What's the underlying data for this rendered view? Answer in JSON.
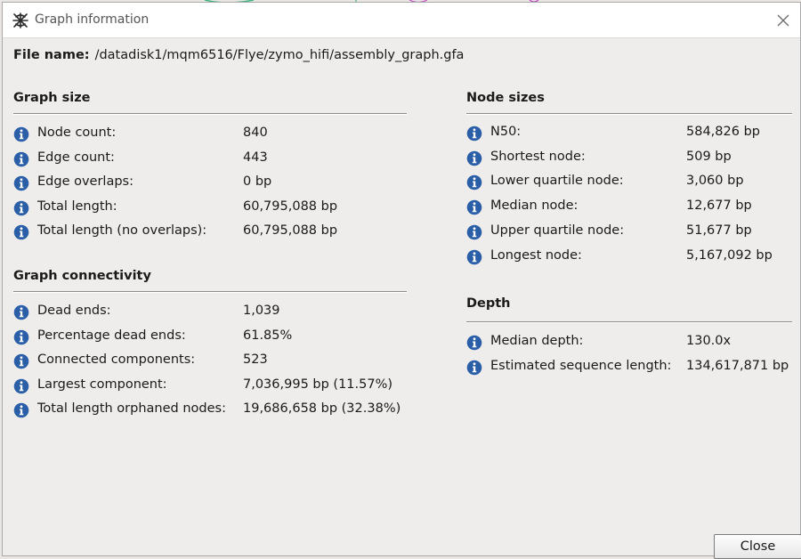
{
  "window": {
    "title": "Graph information",
    "close_icon": "close-icon",
    "app_icon": "bandage-app-icon"
  },
  "file": {
    "label": "File name:",
    "value": "/datadisk1/mqm6516/Flye/zymo_hifi/assembly_graph.gfa"
  },
  "graph_size": {
    "title": "Graph size",
    "items": [
      {
        "label": "Node count:",
        "value": "840"
      },
      {
        "label": "Edge count:",
        "value": "443"
      },
      {
        "label": "Edge overlaps:",
        "value": "0 bp"
      },
      {
        "label": "Total length:",
        "value": "60,795,088 bp"
      },
      {
        "label": "Total length (no overlaps):",
        "value": "60,795,088 bp"
      }
    ]
  },
  "graph_connectivity": {
    "title": "Graph connectivity",
    "items": [
      {
        "label": "Dead ends:",
        "value": "1,039"
      },
      {
        "label": "Percentage dead ends:",
        "value": "61.85%"
      },
      {
        "label": "Connected components:",
        "value": "523"
      },
      {
        "label": "Largest component:",
        "value": "7,036,995 bp (11.57%)"
      },
      {
        "label": "Total length orphaned nodes:",
        "value": "19,686,658 bp (32.38%)"
      }
    ]
  },
  "node_sizes": {
    "title": "Node sizes",
    "items": [
      {
        "label": "N50:",
        "value": "584,826 bp"
      },
      {
        "label": "Shortest node:",
        "value": "509 bp"
      },
      {
        "label": "Lower quartile node:",
        "value": "3,060 bp"
      },
      {
        "label": "Median node:",
        "value": "12,677 bp"
      },
      {
        "label": "Upper quartile node:",
        "value": "51,677 bp"
      },
      {
        "label": "Longest node:",
        "value": "5,167,092 bp"
      }
    ]
  },
  "depth": {
    "title": "Depth",
    "items": [
      {
        "label": "Median depth:",
        "value": "130.0x"
      },
      {
        "label": "Estimated sequence length:",
        "value": "134,617,871 bp"
      }
    ]
  },
  "buttons": {
    "close_label": "Close"
  },
  "colors": {
    "info_icon": "#2a5fa8",
    "dialog_bg": "#efedeb",
    "titlebar_bg": "#ffffff"
  }
}
